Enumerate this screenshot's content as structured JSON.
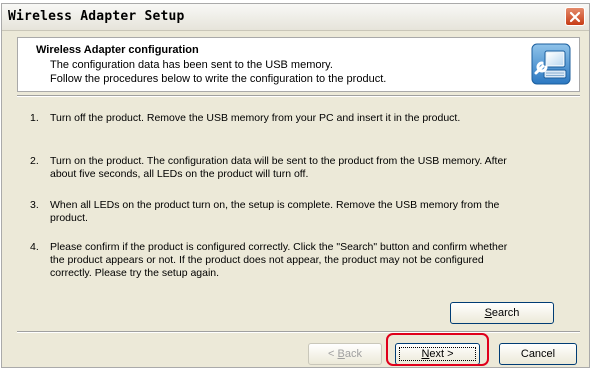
{
  "window": {
    "title": "Wireless Adapter Setup"
  },
  "header": {
    "title": "Wireless Adapter configuration",
    "line1": "The configuration data has been sent to the USB memory.",
    "line2": "Follow the procedures below to write the configuration to the product."
  },
  "steps": [
    {
      "num": "1.",
      "line1": "Turn off the product. Remove the USB memory from your PC and insert it in the product."
    },
    {
      "num": "2.",
      "line1": "Turn on the product. The configuration data will be sent to the product from the USB memory. After",
      "line2": "about five seconds, all LEDs on the product will turn off."
    },
    {
      "num": "3.",
      "line1": "When all LEDs on the product turn on, the setup is complete. Remove the USB memory from the",
      "line2": "product."
    },
    {
      "num": "4.",
      "line1": "Please confirm if the product is configured correctly. Click the \"Search\" button and confirm whether",
      "line2": "the product appears or not. If the product does not appear, the product may not be configured",
      "line3": "correctly. Please try the setup again."
    }
  ],
  "buttons": {
    "search": {
      "mnemonic": "S",
      "rest": "earch"
    },
    "back": {
      "prefix": "< ",
      "mnemonic": "B",
      "rest": "ack"
    },
    "next": {
      "mnemonic": "N",
      "rest": "ext >"
    },
    "cancel": "Cancel"
  },
  "colors": {
    "dialog_bg": "#ece9d8",
    "highlight": "#e0001b",
    "close_button": "#c73d17"
  },
  "icons": {
    "close": "close-icon",
    "header": "computer-wrench-icon"
  }
}
